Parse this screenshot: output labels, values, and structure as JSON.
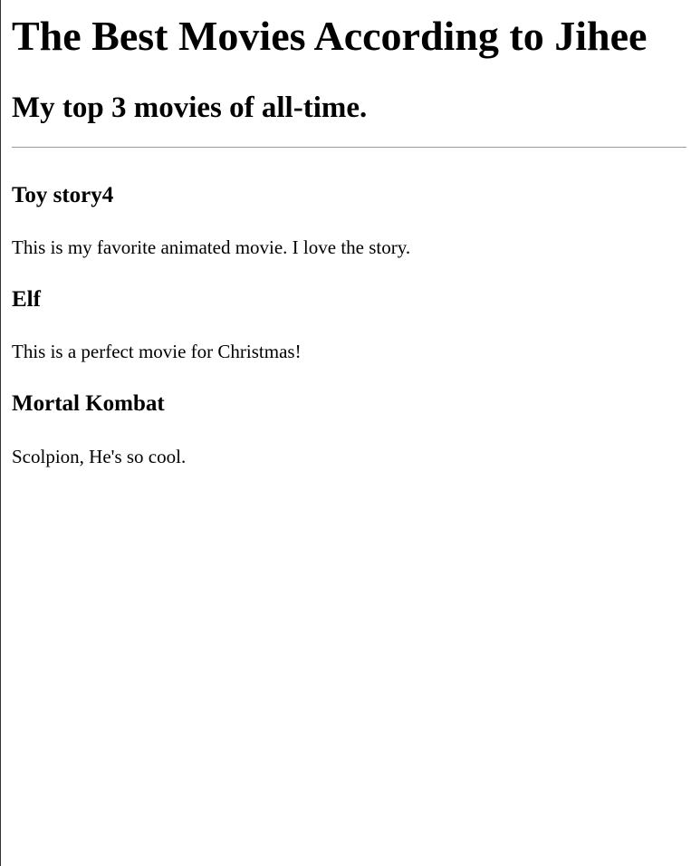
{
  "page": {
    "title": "The Best Movies According to Jihee",
    "subtitle": "My top 3 movies of all-time."
  },
  "movies": [
    {
      "title": "Toy story4",
      "description": "This is my favorite animated movie. I love the story."
    },
    {
      "title": "Elf",
      "description": "This is a perfect movie for Christmas!"
    },
    {
      "title": "Mortal Kombat",
      "description": "Scolpion, He's so cool."
    }
  ]
}
